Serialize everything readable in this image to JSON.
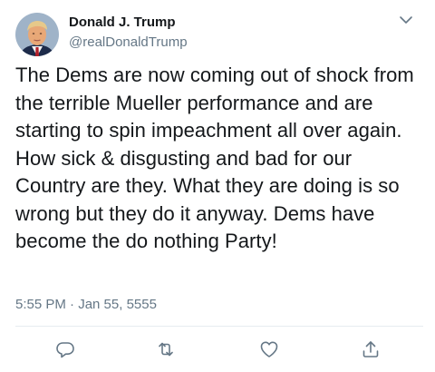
{
  "author": {
    "display_name": "Donald J. Trump",
    "handle": "@realDonaldTrump",
    "avatar_icon": "profile-photo-avatar"
  },
  "menu": {
    "icon": "chevron-down-icon"
  },
  "tweet": {
    "text": "The Dems are now coming out of shock from the terrible Mueller performance and are starting to spin impeachment all over again. How sick & disgusting and bad for our Country are they. What they are doing is so wrong but they do it anyway. Dems have become the do nothing Party!",
    "timestamp": "5:55 PM · Jan 55, 5555"
  },
  "actions": [
    {
      "name": "reply",
      "icon": "reply-icon"
    },
    {
      "name": "retweet",
      "icon": "retweet-icon"
    },
    {
      "name": "like",
      "icon": "heart-icon"
    },
    {
      "name": "share",
      "icon": "share-icon"
    }
  ],
  "colors": {
    "text_primary": "#14171a",
    "text_secondary": "#657786",
    "icon_gray": "#657786",
    "divider": "#e6ecf0"
  }
}
